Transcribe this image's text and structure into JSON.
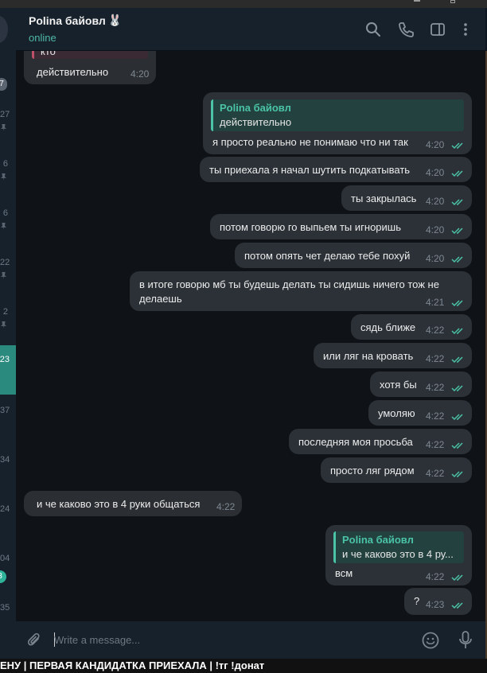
{
  "header": {
    "contact_name": "Polina байовл",
    "contact_emoji": "🐰",
    "status": "online"
  },
  "left_list": {
    "badges": [
      "7"
    ],
    "times": [
      "27",
      "6",
      "6",
      "22",
      "2",
      "23",
      "37",
      "34",
      "24",
      "04",
      "35"
    ],
    "green_badge": "3"
  },
  "messages": {
    "m0": {
      "reply_text": "кто",
      "text": "действительно",
      "time": "4:20"
    },
    "m1": {
      "reply_name": "Polina байовл",
      "reply_text": "действительно",
      "text": "я просто реально не понимаю что ни так",
      "time": "4:20"
    },
    "m2": {
      "text": "ты приехала я начал шутить подкатывать",
      "time": "4:20"
    },
    "m3": {
      "text": "ты закрылась",
      "time": "4:20"
    },
    "m4": {
      "text": "потом говорю го выпьем ты игноришь",
      "time": "4:20"
    },
    "m5": {
      "text": "потом опять чет делаю тебе похуй",
      "time": "4:20"
    },
    "m6": {
      "text_line1": "в итоге говорю мб ты будешь делать ты сидишь ничего тож не",
      "text_line2": "делаешь",
      "time": "4:21"
    },
    "m7": {
      "text": "сядь ближе",
      "time": "4:22"
    },
    "m8": {
      "text": "или ляг на кровать",
      "time": "4:22"
    },
    "m9": {
      "text": "хотя бы",
      "time": "4:22"
    },
    "m10": {
      "text": "умоляю",
      "time": "4:22"
    },
    "m11": {
      "text": "последняя моя просьба",
      "time": "4:22"
    },
    "m12": {
      "text": "просто ляг рядом",
      "time": "4:22"
    },
    "m13": {
      "text": "и че каково это в 4 руки общаться",
      "time": "4:22"
    },
    "m14": {
      "reply_name": "Polina байовл",
      "reply_text": "и че каково это в 4 ру...",
      "text": "всм",
      "time": "4:22"
    },
    "m15": {
      "text": "?",
      "time": "4:23"
    }
  },
  "composer": {
    "placeholder": "Write a message..."
  },
  "stream_ticker": "ЕНУ | ПЕРВАЯ КАНДИДАТКА ПРИЕХАЛА | !тг !донат",
  "colors": {
    "accent": "#4ac3a6",
    "outgoing_bubble": "#2b3137",
    "background": "#0f1216"
  },
  "icons": [
    "search-icon",
    "phone-icon",
    "sidebar-toggle-icon",
    "more-vertical-icon",
    "attach-icon",
    "emoji-icon",
    "microphone-icon",
    "double-check-icon"
  ]
}
